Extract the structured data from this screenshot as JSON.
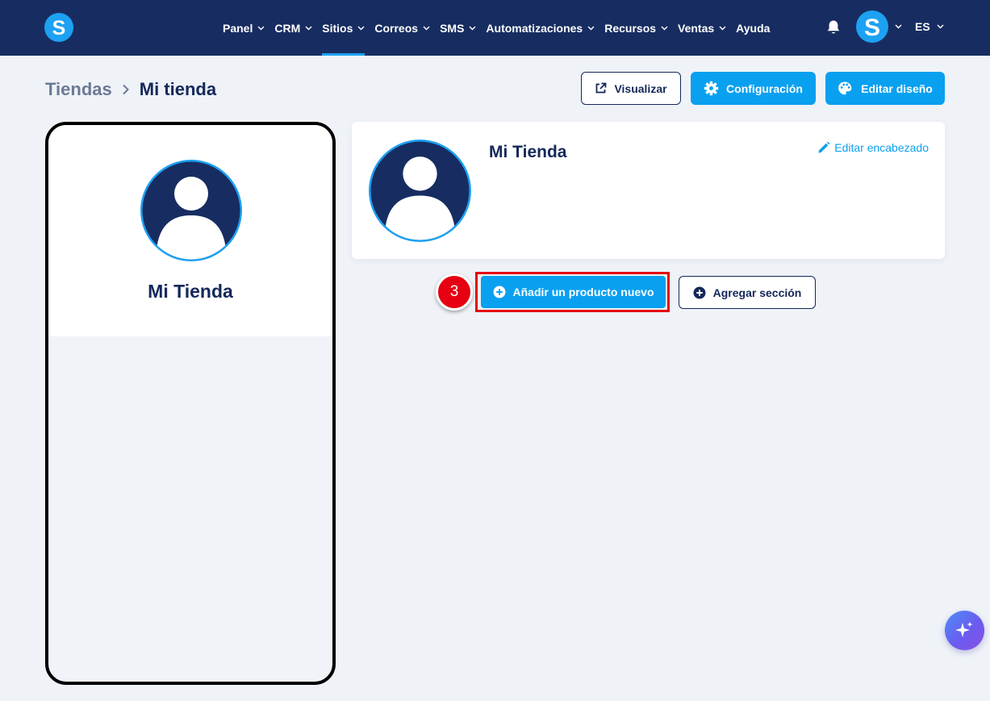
{
  "nav": {
    "items": [
      {
        "label": "Panel",
        "dropdown": true
      },
      {
        "label": "CRM",
        "dropdown": true
      },
      {
        "label": "Sitios",
        "dropdown": true,
        "active": true
      },
      {
        "label": "Correos",
        "dropdown": true
      },
      {
        "label": "SMS",
        "dropdown": true
      },
      {
        "label": "Automatizaciones",
        "dropdown": true
      },
      {
        "label": "Recursos",
        "dropdown": true
      },
      {
        "label": "Ventas",
        "dropdown": true
      },
      {
        "label": "Ayuda",
        "dropdown": false
      }
    ],
    "language": "ES"
  },
  "breadcrumb": {
    "root": "Tiendas",
    "current": "Mi tienda"
  },
  "actions": {
    "preview": "Visualizar",
    "settings": "Configuración",
    "edit_design": "Editar diseño"
  },
  "phone_preview": {
    "store_name": "Mi Tienda"
  },
  "header_card": {
    "store_name": "Mi Tienda",
    "edit_header": "Editar encabezado"
  },
  "buttons": {
    "add_product": "Añadir un producto nuevo",
    "add_section": "Agregar sección"
  },
  "annotation": {
    "step_number": "3"
  },
  "colors": {
    "nav_bg": "#172d61",
    "accent": "#0aa0f0",
    "text_dark": "#14285a",
    "highlight": "#e60012",
    "page_bg": "#eff3f8"
  },
  "icons": {
    "logo": "s-logo-icon",
    "bell": "bell-icon",
    "preview": "external-link-icon",
    "settings": "gear-icon",
    "design": "palette-icon",
    "edit": "pencil-icon",
    "add": "plus-circle-icon",
    "ai": "sparkle-icon"
  }
}
